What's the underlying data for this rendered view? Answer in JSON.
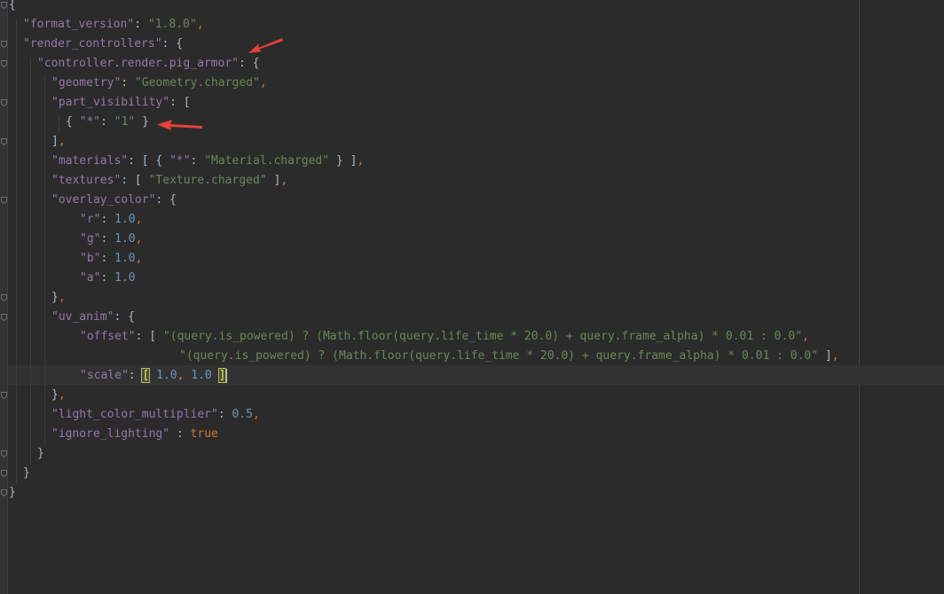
{
  "editor": {
    "lines": [
      {
        "indent": 0,
        "tokens": [
          [
            "p",
            "{"
          ]
        ]
      },
      {
        "indent": 1,
        "tokens": [
          [
            "k",
            "\"format_version\""
          ],
          [
            "p",
            ": "
          ],
          [
            "s",
            "\"1.8.0\""
          ],
          [
            "c",
            ","
          ]
        ]
      },
      {
        "indent": 1,
        "tokens": [
          [
            "k",
            "\"render_controllers\""
          ],
          [
            "p",
            ": {"
          ]
        ]
      },
      {
        "indent": 2,
        "tokens": [
          [
            "k",
            "\"controller.render.pig_armor\""
          ],
          [
            "p",
            ": {"
          ]
        ]
      },
      {
        "indent": 3,
        "tokens": [
          [
            "k",
            "\"geometry\""
          ],
          [
            "p",
            ": "
          ],
          [
            "s",
            "\"Geometry.charged\""
          ],
          [
            "c",
            ","
          ]
        ]
      },
      {
        "indent": 3,
        "tokens": [
          [
            "k",
            "\"part_visibility\""
          ],
          [
            "p",
            ": ["
          ]
        ]
      },
      {
        "indent": 4,
        "tokens": [
          [
            "p",
            "{ "
          ],
          [
            "k",
            "\"*\""
          ],
          [
            "p",
            ": "
          ],
          [
            "s",
            "\"1\""
          ],
          [
            "p",
            " }"
          ]
        ]
      },
      {
        "indent": 3,
        "tokens": [
          [
            "p",
            "]"
          ],
          [
            "c",
            ","
          ]
        ]
      },
      {
        "indent": 3,
        "tokens": [
          [
            "k",
            "\"materials\""
          ],
          [
            "p",
            ": [ { "
          ],
          [
            "k",
            "\"*\""
          ],
          [
            "p",
            ": "
          ],
          [
            "s",
            "\"Material.charged\""
          ],
          [
            "p",
            " } ]"
          ],
          [
            "c",
            ","
          ]
        ]
      },
      {
        "indent": 3,
        "tokens": [
          [
            "k",
            "\"textures\""
          ],
          [
            "p",
            ": [ "
          ],
          [
            "s",
            "\"Texture.charged\""
          ],
          [
            "p",
            " ]"
          ],
          [
            "c",
            ","
          ]
        ]
      },
      {
        "indent": 3,
        "tokens": [
          [
            "k",
            "\"overlay_color\""
          ],
          [
            "p",
            ": {"
          ]
        ]
      },
      {
        "indent": 5,
        "tokens": [
          [
            "k",
            "\"r\""
          ],
          [
            "p",
            ": "
          ],
          [
            "n",
            "1.0"
          ],
          [
            "c",
            ","
          ]
        ]
      },
      {
        "indent": 5,
        "tokens": [
          [
            "k",
            "\"g\""
          ],
          [
            "p",
            ": "
          ],
          [
            "n",
            "1.0"
          ],
          [
            "c",
            ","
          ]
        ]
      },
      {
        "indent": 5,
        "tokens": [
          [
            "k",
            "\"b\""
          ],
          [
            "p",
            ": "
          ],
          [
            "n",
            "1.0"
          ],
          [
            "c",
            ","
          ]
        ]
      },
      {
        "indent": 5,
        "tokens": [
          [
            "k",
            "\"a\""
          ],
          [
            "p",
            ": "
          ],
          [
            "n",
            "1.0"
          ]
        ]
      },
      {
        "indent": 3,
        "tokens": [
          [
            "p",
            "}"
          ],
          [
            "c",
            ","
          ]
        ]
      },
      {
        "indent": 3,
        "tokens": [
          [
            "k",
            "\"uv_anim\""
          ],
          [
            "p",
            ": {"
          ]
        ]
      },
      {
        "indent": 5,
        "tokens": [
          [
            "k",
            "\"offset\""
          ],
          [
            "p",
            ": [ "
          ],
          [
            "s",
            "\"(query.is_powered) ? (Math.floor(query.life_time * 20.0) + query.frame_alpha) * 0.01 : 0.0\""
          ],
          [
            "c",
            ","
          ]
        ]
      },
      {
        "indent": 11,
        "extra": 2,
        "tokens": [
          [
            "s",
            "\"(query.is_powered) ? (Math.floor(query.life_time * 20.0) + query.frame_alpha) * 0.01 : 0.0\""
          ],
          [
            "p",
            " ]"
          ],
          [
            "c",
            ","
          ]
        ]
      },
      {
        "indent": 5,
        "tokens": [
          [
            "k",
            "\"scale\""
          ],
          [
            "p",
            ": "
          ],
          [
            "m",
            "["
          ],
          [
            "p",
            " "
          ],
          [
            "n",
            "1.0"
          ],
          [
            "c",
            ","
          ],
          [
            "p",
            " "
          ],
          [
            "n",
            "1.0"
          ],
          [
            "p",
            " "
          ],
          [
            "m",
            "]"
          ],
          [
            "caret",
            ""
          ]
        ]
      },
      {
        "indent": 3,
        "tokens": [
          [
            "p",
            "}"
          ],
          [
            "c",
            ","
          ]
        ]
      },
      {
        "indent": 3,
        "tokens": [
          [
            "k",
            "\"light_color_multiplier\""
          ],
          [
            "p",
            ": "
          ],
          [
            "n",
            "0.5"
          ],
          [
            "c",
            ","
          ]
        ]
      },
      {
        "indent": 3,
        "tokens": [
          [
            "k",
            "\"ignore_lighting\""
          ],
          [
            "p",
            " : "
          ],
          [
            "b",
            "true"
          ]
        ]
      },
      {
        "indent": 2,
        "tokens": [
          [
            "p",
            "}"
          ]
        ]
      },
      {
        "indent": 1,
        "tokens": [
          [
            "p",
            "}"
          ]
        ]
      },
      {
        "indent": 0,
        "tokens": [
          [
            "p",
            "}"
          ]
        ]
      }
    ]
  },
  "colors": {
    "background": "#2b2b2b",
    "key": "#9876aa",
    "string": "#6a8759",
    "number": "#6897bb",
    "keyword": "#cc7832",
    "punctuation": "#a9b7c6",
    "annotation_arrow": "#e8403a"
  },
  "annotations": [
    "red-arrow-render-controllers",
    "red-arrow-part-visibility"
  ]
}
